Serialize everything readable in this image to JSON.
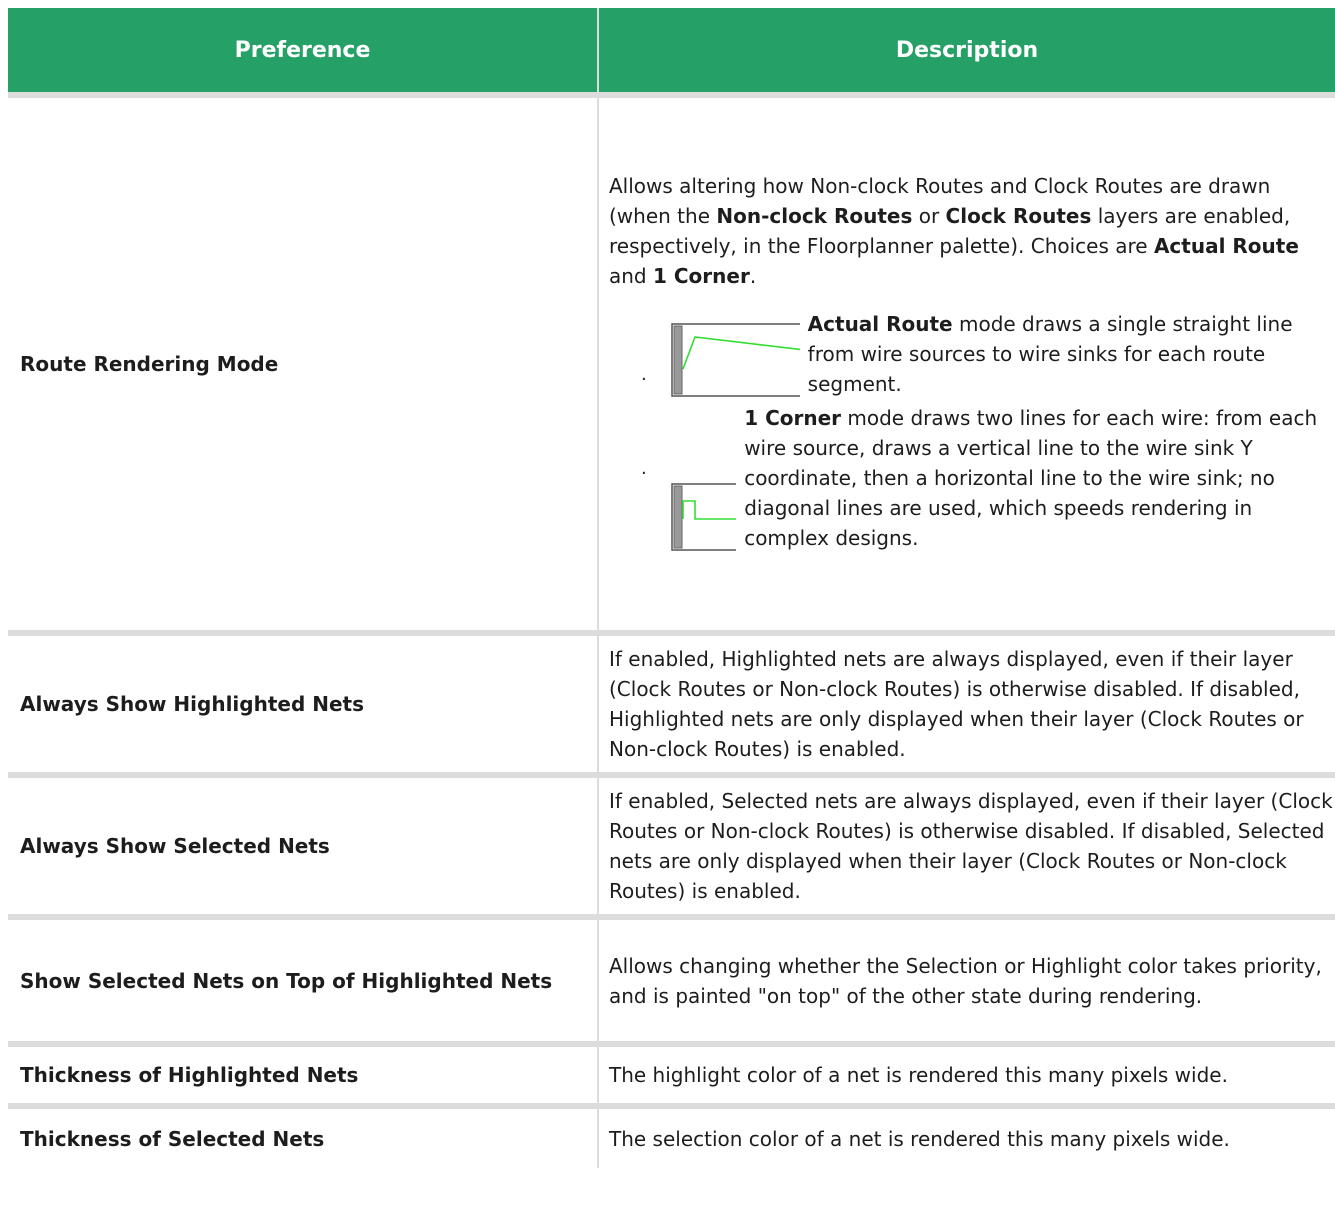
{
  "table": {
    "headers": {
      "preference": "Preference",
      "description": "Description"
    },
    "rows": [
      {
        "preference": "Route Rendering Mode",
        "description": {
          "intro_1": "Allows altering how Non-clock Routes and Clock Routes are drawn (when the ",
          "bold_1": "Non-clock Routes",
          "intro_2": " or ",
          "bold_2": "Clock Routes",
          "intro_3": " layers are enabled, respectively, in the Floorplanner palette). Choices are ",
          "bold_3": "Actual Route",
          "intro_4": " and ",
          "bold_4": "1 Corner",
          "intro_5": ".",
          "modes": [
            {
              "name": "Actual Route",
              "text": " mode draws a single straight line from wire sources to wire sinks for each route segment."
            },
            {
              "name": "1 Corner",
              "text": " mode draws two lines for each wire: from each wire source, draws a vertical line to the wire sink Y coordinate, then a horizontal line to the wire sink; no diagonal lines are used, which speeds rendering in complex designs."
            }
          ]
        }
      },
      {
        "preference": "Always Show Highlighted Nets",
        "description": "If enabled, Highlighted nets are always displayed, even if their layer (Clock Routes or Non-clock Routes) is otherwise disabled. If disabled, Highlighted nets are only displayed when their layer (Clock Routes or Non-clock Routes) is enabled."
      },
      {
        "preference": "Always Show Selected Nets",
        "description": "If enabled, Selected nets are always displayed, even if their layer (Clock Routes or Non-clock Routes) is otherwise disabled. If disabled, Selected nets are only displayed when their layer (Clock Routes or Non-clock Routes) is enabled."
      },
      {
        "preference": "Show Selected Nets on Top of Highlighted Nets",
        "description": "Allows changing whether the Selection or Highlight color takes priority, and is painted \"on top\" of the other state during rendering."
      },
      {
        "preference": "Thickness of Highlighted Nets",
        "description": "The highlight color of a net is rendered this many pixels wide."
      },
      {
        "preference": "Thickness of Selected Nets",
        "description": "The selection color of a net is rendered this many pixels wide."
      }
    ]
  },
  "colors": {
    "header_bg": "#25a167",
    "header_text": "#ffffff",
    "row_divider": "#dcdcdc",
    "route_line": "#33dd33"
  }
}
